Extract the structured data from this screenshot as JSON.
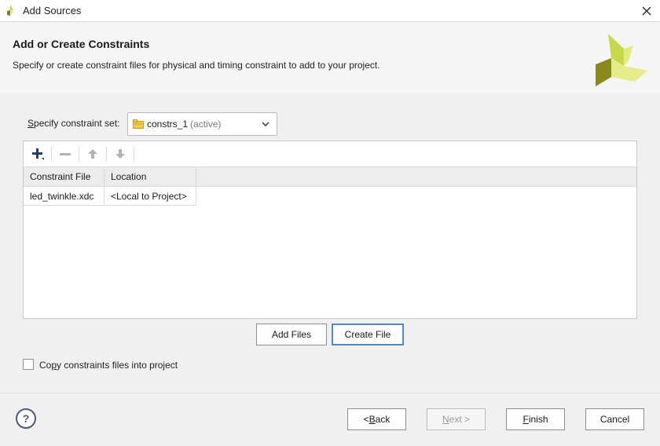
{
  "window": {
    "title": "Add Sources"
  },
  "header": {
    "title": "Add or Create Constraints",
    "description": "Specify or create constraint files for physical and timing constraint to add to your project."
  },
  "constraint_set": {
    "label_prefix": "S",
    "label_rest": "pecify constraint set:",
    "value": "constrs_1",
    "suffix": "(active)"
  },
  "toolbar": {
    "add_icon": "plus-icon",
    "remove_icon": "minus-icon",
    "up_icon": "arrow-up-icon",
    "down_icon": "arrow-down-icon"
  },
  "table": {
    "columns": [
      "Constraint File",
      "Location"
    ],
    "rows": [
      {
        "file": "led_twinkle.xdc",
        "location": "<Local to Project>"
      }
    ]
  },
  "buttons": {
    "add_files": "Add Files",
    "create_file": "Create File"
  },
  "copy_option": {
    "label_pre": "Co",
    "label_u": "p",
    "label_post": "y constraints files into project",
    "checked": false
  },
  "footer": {
    "help": "?",
    "back_pre": "< ",
    "back_u": "B",
    "back_post": "ack",
    "next_u": "N",
    "next_post": "ext >",
    "finish_u": "F",
    "finish_post": "inish",
    "cancel": "Cancel"
  },
  "colors": {
    "accent_focus": "#4f87c7",
    "logo_light": "#d9e06a",
    "logo_dark": "#8a8a1c"
  }
}
